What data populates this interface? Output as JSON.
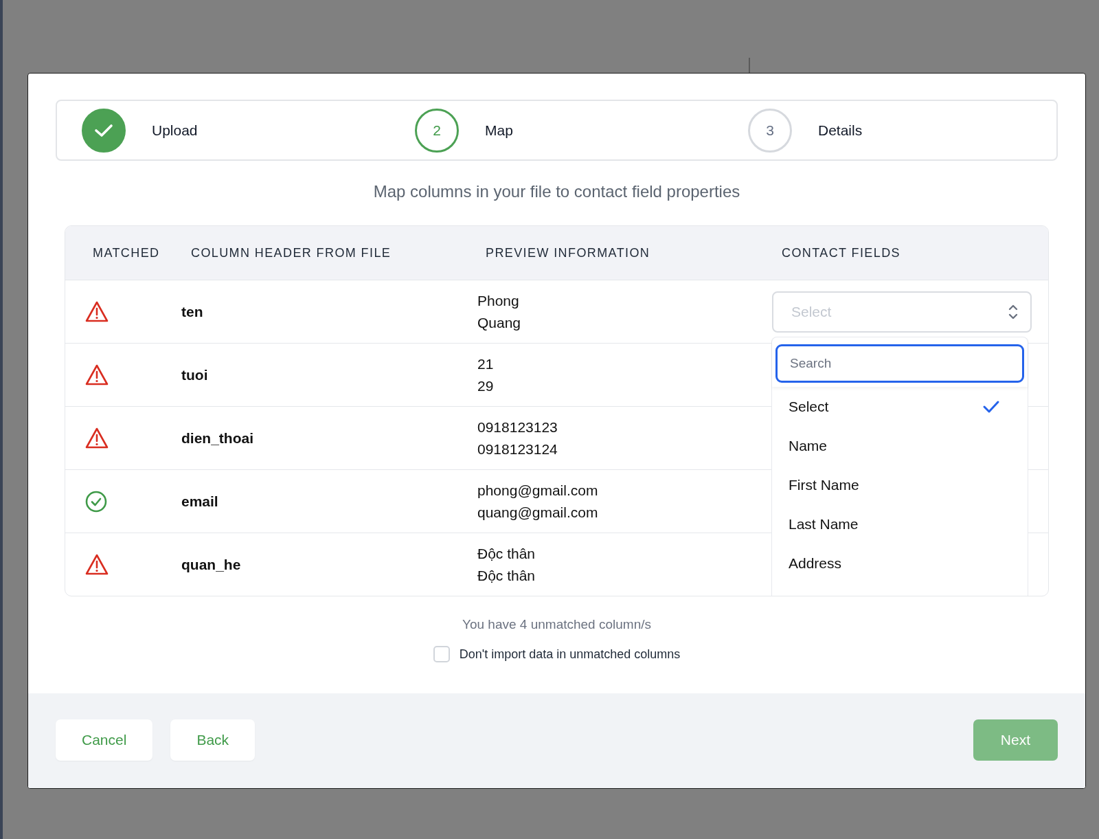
{
  "modal": {
    "steps": [
      {
        "label": "Upload",
        "completed": true,
        "active": false
      },
      {
        "number": "2",
        "label": "Map",
        "completed": false,
        "active": true
      },
      {
        "number": "3",
        "label": "Details",
        "completed": false,
        "active": false
      }
    ],
    "subtitle": "Map columns in your file to contact field properties",
    "table": {
      "columns": [
        "MATCHED",
        "COLUMN HEADER FROM FILE",
        "PREVIEW INFORMATION",
        "CONTACT FIELDS"
      ],
      "rows": [
        {
          "matched": false,
          "column": "ten",
          "preview": [
            "Phong",
            "Quang"
          ],
          "field": {
            "placeholder": "Select"
          }
        },
        {
          "matched": false,
          "column": "tuoi",
          "preview": [
            "21",
            "29"
          ]
        },
        {
          "matched": false,
          "column": "dien_thoai",
          "preview": [
            "0918123123",
            "0918123124"
          ]
        },
        {
          "matched": true,
          "column": "email",
          "preview": [
            "phong@gmail.com",
            "quang@gmail.com"
          ]
        },
        {
          "matched": false,
          "column": "quan_he",
          "preview": [
            "Độc thân",
            "Độc thân"
          ]
        }
      ]
    },
    "dropdown": {
      "search_placeholder": "Search",
      "options": [
        {
          "label": "Select",
          "selected": true
        },
        {
          "label": "Name",
          "selected": false
        },
        {
          "label": "First Name",
          "selected": false
        },
        {
          "label": "Last Name",
          "selected": false
        },
        {
          "label": "Address",
          "selected": false
        }
      ]
    },
    "unmatched_note": "You have 4 unmatched column/s",
    "skip_unmatched": {
      "label": "Don't import data in unmatched columns",
      "checked": false
    },
    "buttons": [
      {
        "label": "Cancel",
        "kind": "secondary"
      },
      {
        "label": "Back",
        "kind": "secondary"
      },
      {
        "label": "Next",
        "kind": "primary",
        "disabled": true
      }
    ]
  }
}
